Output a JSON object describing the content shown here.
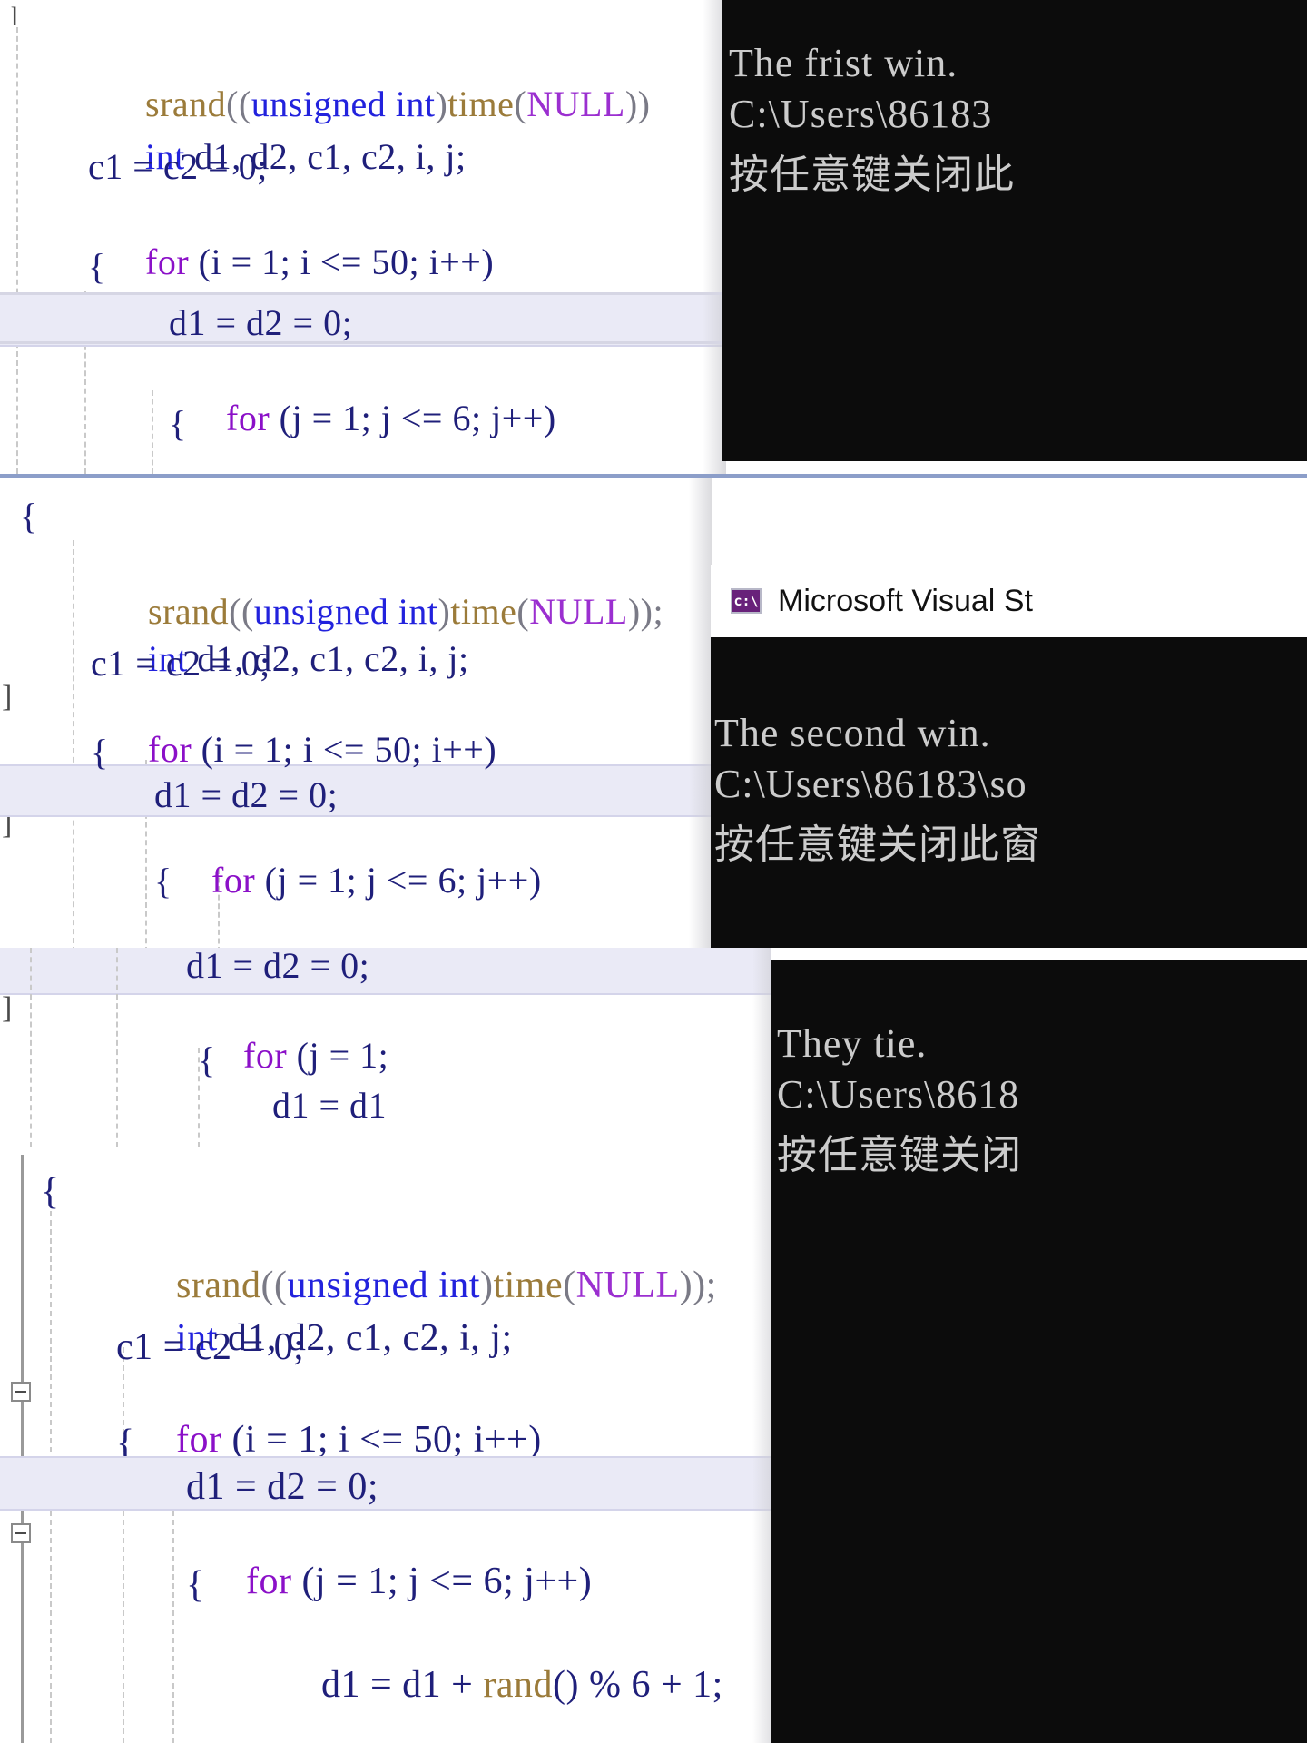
{
  "app": {
    "window_title": "Microsoft Visual St",
    "titlebar_icon": "console-cmd-icon"
  },
  "code": {
    "lines": [
      "srand((unsigned int)time(NULL));",
      "int d1, d2, c1, c2, i, j;",
      "c1 = c2 = 0;",
      "for (i = 1; i <= 50; i++)",
      "{",
      "d1 = d2 = 0;",
      "for (j = 1; j <= 6; j++)",
      "{",
      "d1 = d1 + rand() % 6 + 1;"
    ],
    "open_brace": "{",
    "tokens": {
      "srand": "srand",
      "unsigned": "unsigned",
      "int": "int",
      "time": "time",
      "null": "NULL",
      "for": "for",
      "rand": "rand"
    },
    "stray_left_bracket": "]",
    "stray_left_glyph": "l"
  },
  "panels": [
    {
      "id": "panel-1",
      "console": {
        "lines": [
          "The frist win.",
          "C:\\Users\\86183",
          "按任意键关闭此"
        ]
      }
    },
    {
      "id": "panel-2",
      "console": {
        "lines": [
          "The second win.",
          "C:\\Users\\86183\\so",
          "按任意键关闭此窗"
        ]
      },
      "titlebar": {
        "title": "Microsoft Visual St"
      }
    },
    {
      "id": "panel-3",
      "console": {
        "lines": [
          "They tie.",
          "C:\\Users\\8618",
          "按任意键关闭"
        ]
      }
    }
  ],
  "colors": {
    "keyword": "#8b10c8",
    "type": "#2222dd",
    "function": "#9b7b3a",
    "macro": "#9b2fd0",
    "identifier": "#1f1f7a",
    "console_bg": "#0c0c0c",
    "console_fg": "#cccccc",
    "highlight_band": "#eaeaf6",
    "separator": "#8c9ec9",
    "titlebar_icon_bg": "#68217a"
  }
}
